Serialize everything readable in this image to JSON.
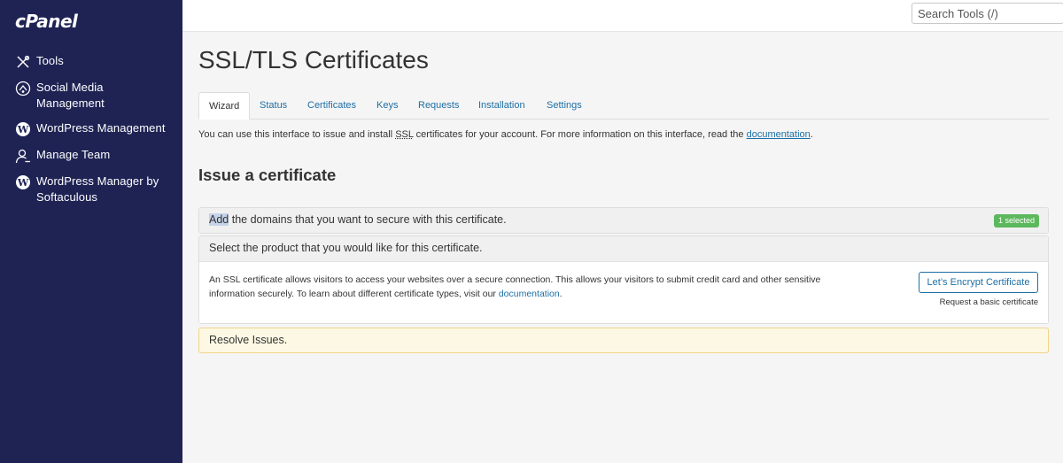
{
  "brand": {
    "logo_text": "cPanel"
  },
  "search": {
    "placeholder": "Search Tools (/)"
  },
  "sidebar": {
    "items": [
      {
        "label": "Tools",
        "icon": "tools-icon"
      },
      {
        "label": "Social Media Management",
        "icon": "social-media-icon"
      },
      {
        "label": "WordPress Management",
        "icon": "wordpress-icon"
      },
      {
        "label": "Manage Team",
        "icon": "team-icon"
      },
      {
        "label": "WordPress Manager by Softaculous",
        "icon": "wordpress-icon"
      }
    ]
  },
  "page": {
    "title": "SSL/TLS Certificates",
    "tabs": [
      "Wizard",
      "Status",
      "Certificates",
      "Keys",
      "Requests",
      "Installation",
      "Settings"
    ],
    "active_tab": "Wizard",
    "intro": {
      "before": "You can use this interface to issue and install ",
      "abbr": "SSL",
      "middle": " certificates for your account. For more information on this interface, read the ",
      "link": "documentation",
      "after": "."
    },
    "section_title": "Issue a certificate",
    "domains_panel": {
      "highlight": "Add",
      "rest": " the domains that you want to secure with this certificate.",
      "badge": "1 selected"
    },
    "product_panel": {
      "heading": "Select the product that you would like for this certificate.",
      "text": "An SSL certificate allows visitors to access your websites over a secure connection. This allows your visitors to submit credit card and other sensitive information securely. To learn about different certificate types, visit our ",
      "link": "documentation",
      "after": ".",
      "button": "Let’s Encrypt Certificate",
      "button_sub": "Request a basic certificate"
    },
    "resolve": "Resolve Issues."
  },
  "colors": {
    "sidebar_bg": "#1f2354",
    "link": "#1d6fa5",
    "badge": "#5cb85c",
    "warning_bg": "#fcf8e3"
  }
}
